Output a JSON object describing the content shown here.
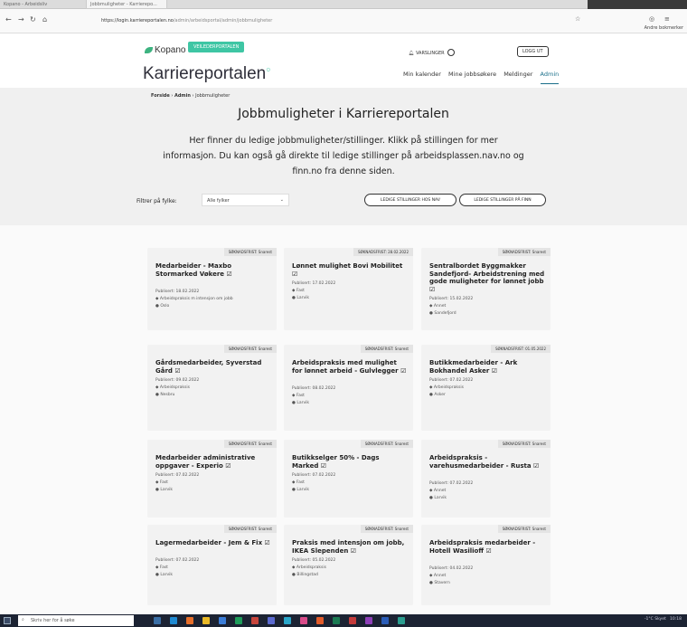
{
  "browser": {
    "window_title": "Kopano - Arbeidsliv",
    "tab_label": "Jobbmuligheter - Karrierepo...",
    "url_host": "https://login.karriereportalen.no",
    "url_path": "/admin/arbeidsportal/admin/jobbmuligheter",
    "bookmarks_label": "Andre bokmerker"
  },
  "header": {
    "logo_text": "Kopano",
    "portal_pill": "VEILEDERPORTALEN",
    "notifications": "VARSLINGER",
    "logout": "LOGG UT",
    "brand": "Karriereportalen",
    "nav": [
      "Min kalender",
      "Mine jobbsøkere",
      "Meldinger",
      "Admin"
    ]
  },
  "breadcrumb": {
    "home": "Forside",
    "admin": "Admin",
    "current": "Jobbmuligheter"
  },
  "page_title": "Jobbmuligheter i Karriereportalen",
  "intro": "Her finner du ledige jobbmuligheter/stillinger. Klikk på stillingen for mer informasjon. Du kan også gå direkte til ledige stillinger på arbeidsplassen.nav.no og finn.no fra denne siden.",
  "filter": {
    "label": "Filtrer på fylke:",
    "selected": "Alle fylker"
  },
  "buttons": {
    "nav": "LEDIGE STILLINGER HOS NAV",
    "finn": "LEDIGE STILLINGER PÅ FINN"
  },
  "jobs": [
    {
      "deadline": "SØKNADSFRIST: Snarest",
      "title": "Medarbeider - Maxbo Stormarked Vøkere ☑",
      "published": "Publisert: 18.02.2022",
      "type": "Arbeidspraksis m intensjon om jobb",
      "location": "Oslo"
    },
    {
      "deadline": "SØKNADSFRIST: 28.02.2022",
      "title": "Lønnet mulighet Bovi Mobilitet ☑",
      "published": "Publisert: 17.02.2022",
      "type": "Fast",
      "location": "Larvik"
    },
    {
      "deadline": "SØKNADSFRIST: Snarest",
      "title": "Sentralbordet Byggmakker Sandefjord- Arbeidstrening med gode muligheter for lønnet jobb ☑",
      "published": "Publisert: 15.02.2022",
      "type": "Annet",
      "location": "Sandefjord"
    },
    {
      "deadline": "SØKNADSFRIST: Snarest",
      "title": "Gårdsmedarbeider, Syverstad Gård ☑",
      "published": "Publisert: 09.02.2022",
      "type": "Arbeidspraksis",
      "location": "Nesbru"
    },
    {
      "deadline": "SØKNADSFRIST: Snarest",
      "title": "Arbeidspraksis med mulighet for lønnet arbeid - Gulvlegger ☑",
      "published": "Publisert: 08.02.2022",
      "type": "Fast",
      "location": "Larvik"
    },
    {
      "deadline": "SØKNADSFRIST: 01.05.2022",
      "title": "Butikkmedarbeider - Ark Bokhandel Asker ☑",
      "published": "Publisert: 07.02.2022",
      "type": "Arbeidspraksis",
      "location": "Asker"
    },
    {
      "deadline": "SØKNADSFRIST: Snarest",
      "title": "Medarbeider administrative oppgaver - Experio ☑",
      "published": "Publisert: 07.02.2022",
      "type": "Fast",
      "location": "Larvik"
    },
    {
      "deadline": "SØKNADSFRIST: Snarest",
      "title": "Butikkselger 50% - Dags Marked ☑",
      "published": "Publisert: 07.02.2022",
      "type": "Fast",
      "location": "Larvik"
    },
    {
      "deadline": "SØKNADSFRIST: Snarest",
      "title": "Arbeidspraksis - varehusmedarbeider - Rusta ☑",
      "published": "Publisert: 07.02.2022",
      "type": "Annet",
      "location": "Larvik"
    },
    {
      "deadline": "SØKNADSFRIST: Snarest",
      "title": "Lagermedarbeider - Jem & Fix ☑",
      "published": "Publisert: 07.02.2022",
      "type": "Fast",
      "location": "Larvik"
    },
    {
      "deadline": "SØKNADSFRIST: Snarest",
      "title": "Praksis med intensjon om jobb, IKEA Slependen ☑",
      "published": "Publisert: 05.02.2022",
      "type": "Arbeidspraksis",
      "location": "Billingstad"
    },
    {
      "deadline": "SØKNADSFRIST: Snarest",
      "title": "Arbeidspraksis medarbeider - Hotell Wasilioff ☑",
      "published": "Publisert: 04.02.2022",
      "type": "Annet",
      "location": "Stavern"
    }
  ],
  "taskbar": {
    "search": "Skriv her for å søke",
    "clock": "10:18",
    "weather": "-1°C Skyet"
  }
}
